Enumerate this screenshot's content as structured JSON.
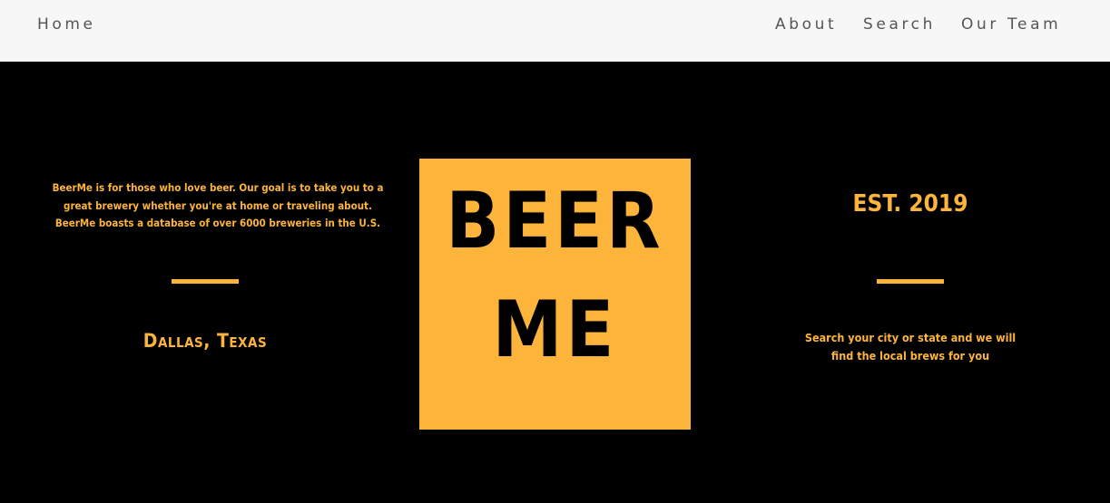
{
  "nav": {
    "home_label": "Home",
    "about_label": "About",
    "search_label": "Search",
    "team_label": "Our Team"
  },
  "hero": {
    "about_text": "BeerMe is for those who love beer. Our goal is to take you to a great brewery whether you're at home or traveling about. BeerMe boasts a database of over 6000 breweries in the U.S.",
    "location": "Dallas, Texas",
    "logo_line_1": "BEER",
    "logo_line_2": "ME",
    "established": "EST. 2019",
    "search_text": "Search your city or state and we will find the local brews for you"
  },
  "colors": {
    "accent": "#fcb43b",
    "background": "#000000",
    "navbar": "#f7f7f7",
    "nav_text": "#555555"
  }
}
